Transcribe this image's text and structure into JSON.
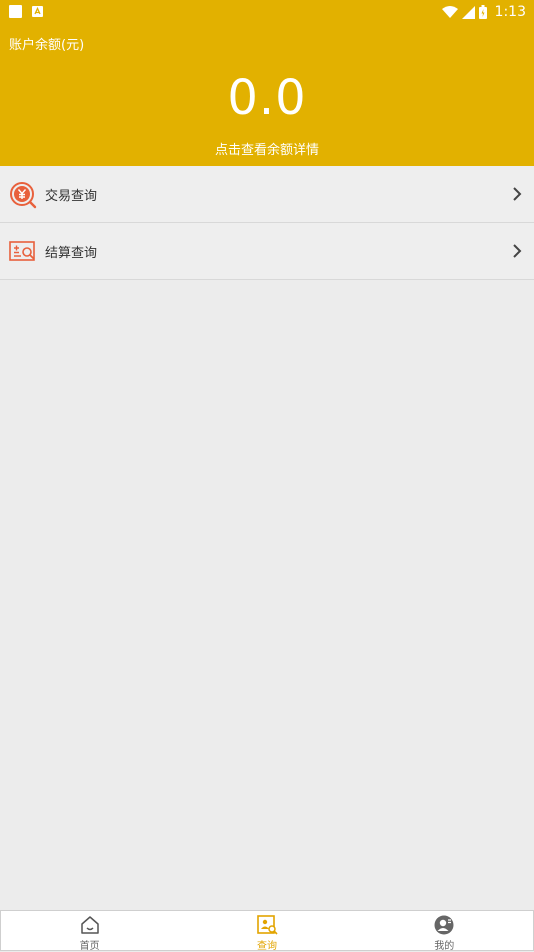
{
  "status_bar": {
    "time": "1:13",
    "icons": [
      "notification-square-icon",
      "notification-a-icon",
      "wifi-icon",
      "signal-icon",
      "battery-icon"
    ]
  },
  "header": {
    "balance_label": "账户余额(元)",
    "balance_value": "0.0",
    "details_link": "点击查看余额详情"
  },
  "menu": {
    "items": [
      {
        "label": "交易查询",
        "icon": "yuan-search-icon"
      },
      {
        "label": "结算查询",
        "icon": "settlement-search-icon"
      }
    ]
  },
  "tabbar": {
    "tabs": [
      {
        "label": "首页",
        "icon": "home-icon",
        "active": false
      },
      {
        "label": "查询",
        "icon": "query-icon",
        "active": true
      },
      {
        "label": "我的",
        "icon": "profile-icon",
        "active": false
      }
    ]
  },
  "colors": {
    "accent": "#e2b100",
    "active_tab": "#e2a400",
    "menu_icon": "#e8603c",
    "background": "#ececec"
  }
}
